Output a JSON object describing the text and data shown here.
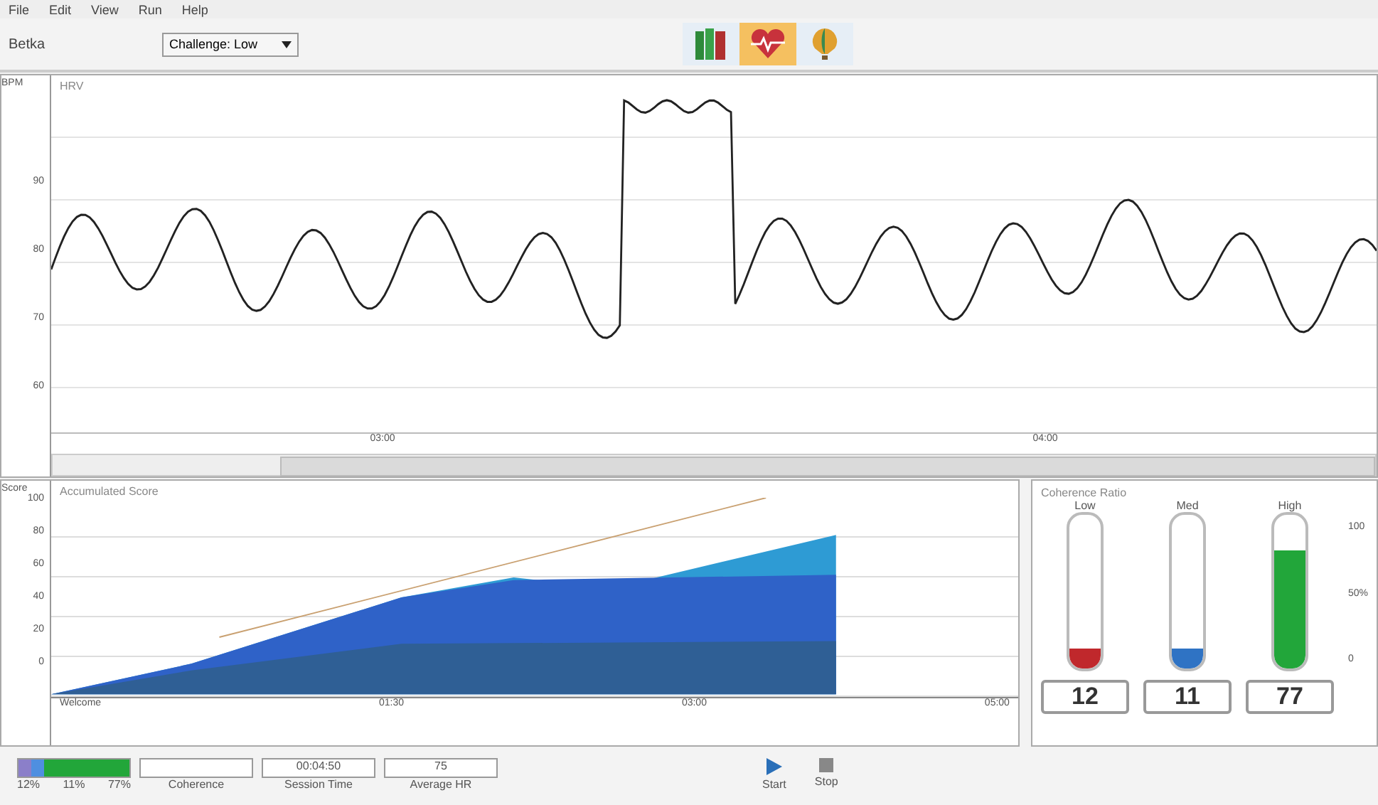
{
  "menu": [
    "File",
    "Edit",
    "View",
    "Run",
    "Help"
  ],
  "toolbar": {
    "user": "Betka",
    "challenge": "Challenge: Low",
    "modes": [
      {
        "kind": "books",
        "selected": false
      },
      {
        "kind": "heart",
        "selected": true
      },
      {
        "kind": "balloon",
        "selected": false
      }
    ]
  },
  "hrv_chart": {
    "unit": "BPM",
    "title": "HRV",
    "y_labels": [
      "90",
      "80",
      "70",
      "60"
    ],
    "x_labels": [
      "03:00",
      "04:00"
    ]
  },
  "score_chart": {
    "unit": "Score",
    "title": "Accumulated Score",
    "y_labels": [
      "100",
      "80",
      "60",
      "40",
      "20",
      "0"
    ],
    "x_labels": [
      "Welcome",
      "01:30",
      "03:00",
      "05:00"
    ]
  },
  "coherence_ratio": {
    "title": "Coherence Ratio",
    "scale": [
      "100",
      "50%",
      "0"
    ],
    "tubes": [
      {
        "label": "Low",
        "level": 0.12,
        "color": "#c0282c",
        "value": "12"
      },
      {
        "label": "Med",
        "level": 0.11,
        "color": "#2f73c4",
        "value": "11"
      },
      {
        "label": "High",
        "level": 0.77,
        "color": "#22a63a",
        "value": "77"
      }
    ]
  },
  "status": {
    "ratio_bar": [
      {
        "level": 0.12,
        "color": "#8b7fc9"
      },
      {
        "level": 0.11,
        "color": "#4f8fe0"
      },
      {
        "level": 0.77,
        "color": "#22a63a"
      }
    ],
    "ratio_labels": [
      "12%",
      "11%",
      "77%"
    ],
    "fields": [
      {
        "label": "Coherence"
      },
      {
        "label": "Session Time",
        "value": "00:04:50"
      },
      {
        "label": "Average HR",
        "value": "75"
      }
    ],
    "buttons": [
      {
        "kind": "start",
        "label": "Start"
      },
      {
        "kind": "stop",
        "label": "Stop"
      }
    ]
  }
}
